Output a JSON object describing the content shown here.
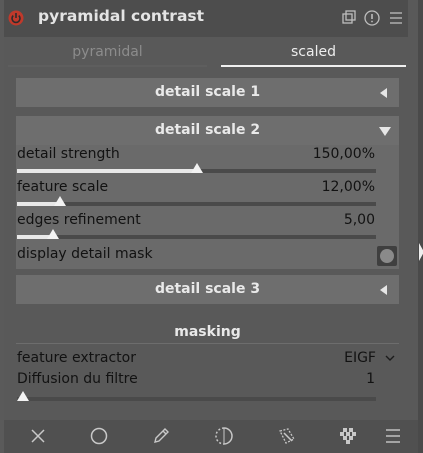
{
  "module": {
    "title": "pyramidal contrast"
  },
  "tabs": [
    {
      "label": "pyramidal",
      "active": false
    },
    {
      "label": "scaled",
      "active": true
    }
  ],
  "sections": {
    "detail_scale_1": {
      "label": "detail scale 1",
      "expanded": false
    },
    "detail_scale_2": {
      "label": "detail scale 2",
      "expanded": true
    },
    "detail_scale_3": {
      "label": "detail scale 3",
      "expanded": false
    }
  },
  "sliders": {
    "detail_strength": {
      "label": "detail strength",
      "value": "150,00%",
      "fraction": 0.5
    },
    "feature_scale": {
      "label": "feature scale",
      "value": "12,00%",
      "fraction": 0.12
    },
    "edges_refinement": {
      "label": "edges refinement",
      "value": "5,00",
      "fraction": 0.1
    },
    "diffusion": {
      "label": "Diffusion du filtre",
      "value": "1",
      "fraction": 0.0
    }
  },
  "display_detail_mask": {
    "label": "display detail mask",
    "enabled": false
  },
  "masking": {
    "title": "masking",
    "feature_extractor": {
      "label": "feature extractor",
      "value": "EIGF"
    }
  },
  "colors": {
    "panel": "#595959",
    "header": "#4d4d4d",
    "section": "#6e6e6e",
    "accent_active_tab": "#f0f0f0",
    "power_icon": "#c0392b"
  },
  "toolbar": {
    "icons": [
      "close-icon",
      "circle-icon",
      "pencil-icon",
      "gradient-icon",
      "path-icon",
      "checkerboard-icon",
      "menu-icon"
    ]
  }
}
